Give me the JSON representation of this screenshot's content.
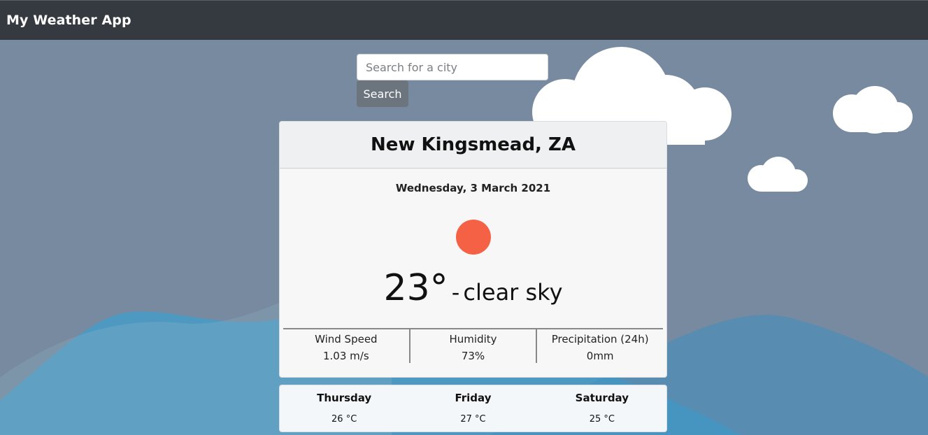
{
  "app": {
    "title": "My Weather App"
  },
  "search": {
    "placeholder": "Search for a city",
    "value": "",
    "button_label": "Search"
  },
  "weather": {
    "city": "New Kingsmead, ZA",
    "date": "Wednesday, 3 March 2021",
    "temperature": "23°",
    "separator": "-",
    "description": "clear sky",
    "icon": "sun-icon",
    "icon_color": "#f56144"
  },
  "stats": [
    {
      "label": "Wind Speed",
      "value": "1.03 m/s"
    },
    {
      "label": "Humidity",
      "value": "73%"
    },
    {
      "label": "Precipitation (24h)",
      "value": "0mm"
    }
  ],
  "forecast": [
    {
      "day": "Thursday",
      "temp": "26 °C"
    },
    {
      "day": "Friday",
      "temp": "27 °C"
    },
    {
      "day": "Saturday",
      "temp": "25 °C"
    }
  ],
  "colors": {
    "navbar": "#343a40",
    "sky": "#778aa0",
    "mountain": "#3e9fcf",
    "button": "#6c757d"
  }
}
